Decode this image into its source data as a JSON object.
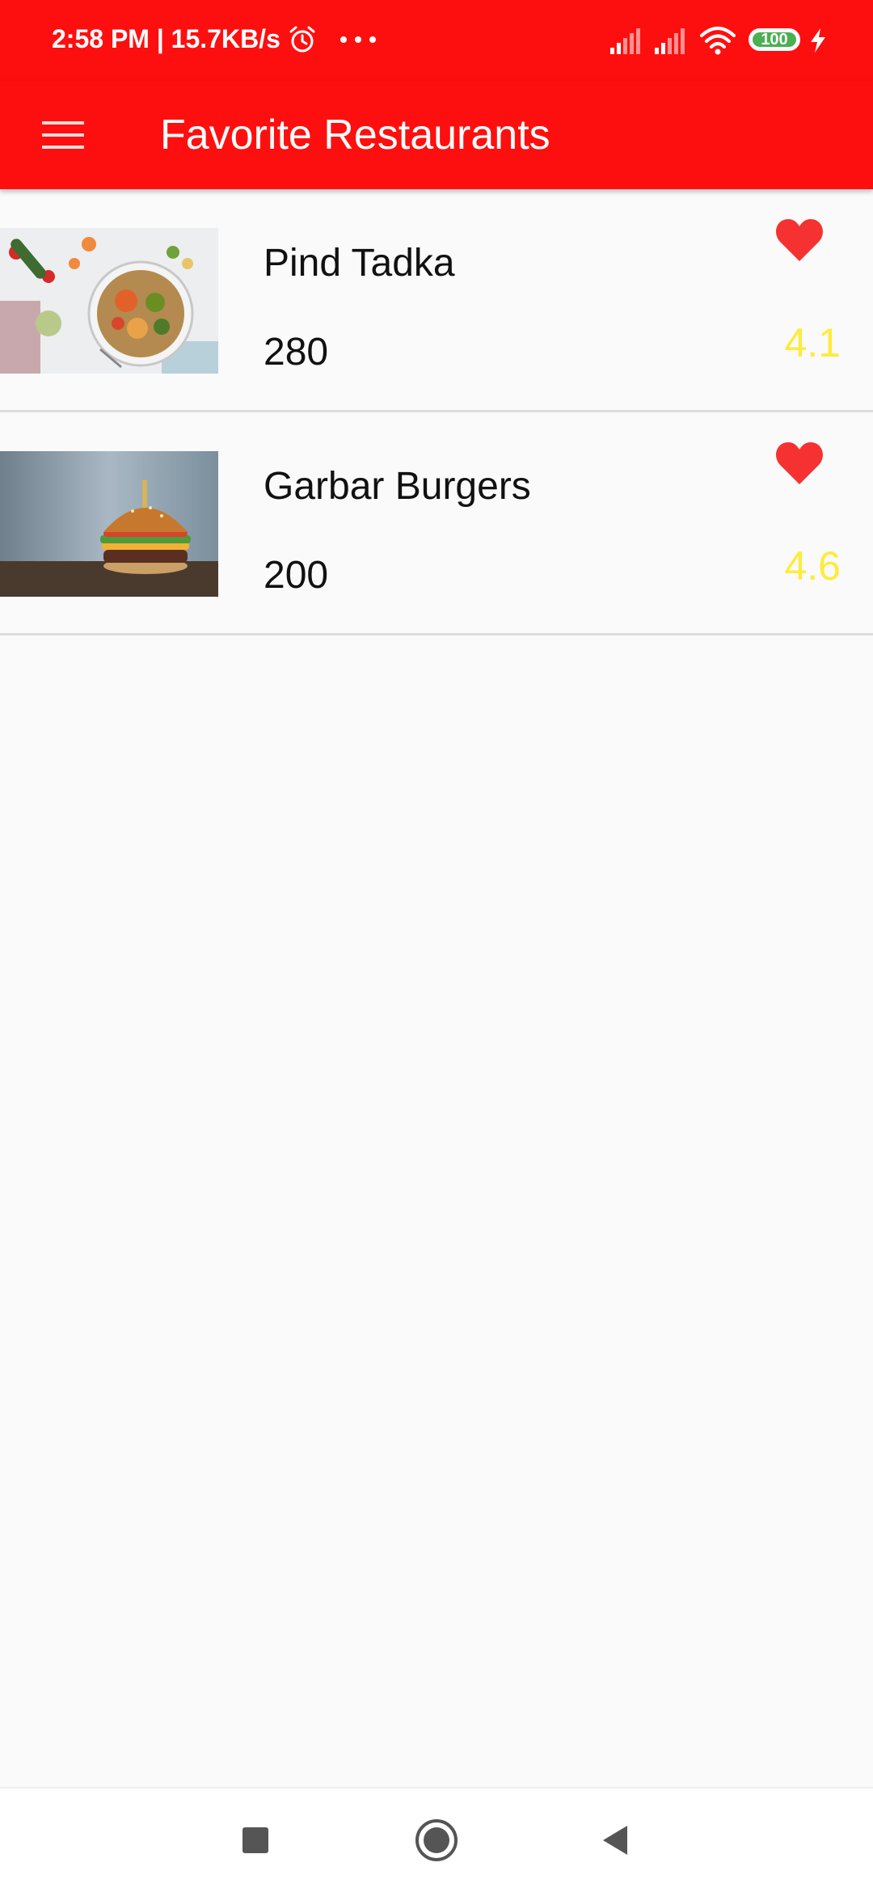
{
  "status_bar": {
    "time_and_speed": "2:58 PM | 15.7KB/s",
    "battery_level": "100",
    "icons": [
      "alarm-icon",
      "more-dots-icon",
      "signal-icon",
      "signal-icon",
      "wifi-icon",
      "battery-icon",
      "charging-icon"
    ]
  },
  "app_bar": {
    "title": "Favorite Restaurants",
    "menu_icon": "menu-icon",
    "color": "#fe0f0f"
  },
  "restaurants": [
    {
      "name": "Pind Tadka",
      "price": "280",
      "rating": "4.1",
      "favorite": true,
      "image": "salad-bowl-photo"
    },
    {
      "name": "Garbar Burgers",
      "price": "200",
      "rating": "4.6",
      "favorite": true,
      "image": "burger-photo"
    }
  ],
  "colors": {
    "accent": "#fe0f0f",
    "rating": "#ffeb3b",
    "heart": "#f53131"
  },
  "nav_bar": {
    "icons": [
      "recent-apps-icon",
      "home-icon",
      "back-icon"
    ]
  }
}
